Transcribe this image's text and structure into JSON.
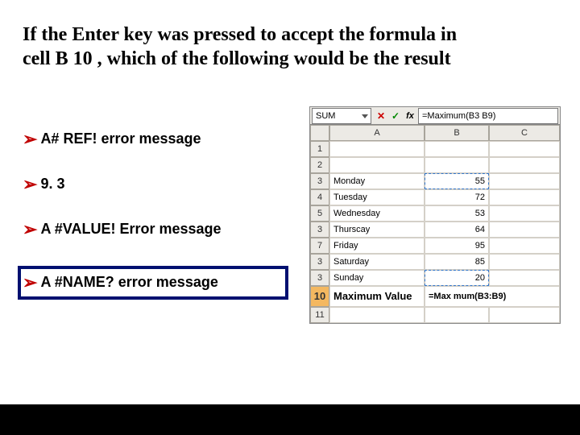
{
  "question": "If the Enter key was pressed to accept the formula in cell B 10 , which of the following would be the result",
  "options": {
    "a": "A# REF! error message",
    "b": "9. 3",
    "c": "A #VALUE! Error message",
    "d": "A #NAME? error message"
  },
  "sheet": {
    "namebox": "SUM",
    "formula": "=Maximum(B3 B9)",
    "col_headers": {
      "a": "A",
      "b": "B",
      "c": "C"
    },
    "row_headers": [
      "1",
      "2",
      "3",
      "4",
      "5",
      "3",
      "7",
      "3",
      "3",
      "10",
      "11"
    ],
    "rows": [
      {
        "a": "",
        "b": ""
      },
      {
        "a": "",
        "b": ""
      },
      {
        "a": "Monday",
        "b": "55"
      },
      {
        "a": "Tuesday",
        "b": "72"
      },
      {
        "a": "Wednesday",
        "b": "53"
      },
      {
        "a": "Thurscay",
        "b": "64"
      },
      {
        "a": "Friday",
        "b": "95"
      },
      {
        "a": "Saturday",
        "b": "85"
      },
      {
        "a": "Sunday",
        "b": "20"
      }
    ],
    "max_label": "Maximum Value",
    "max_formula": "=Max mum(B3:B9)"
  }
}
